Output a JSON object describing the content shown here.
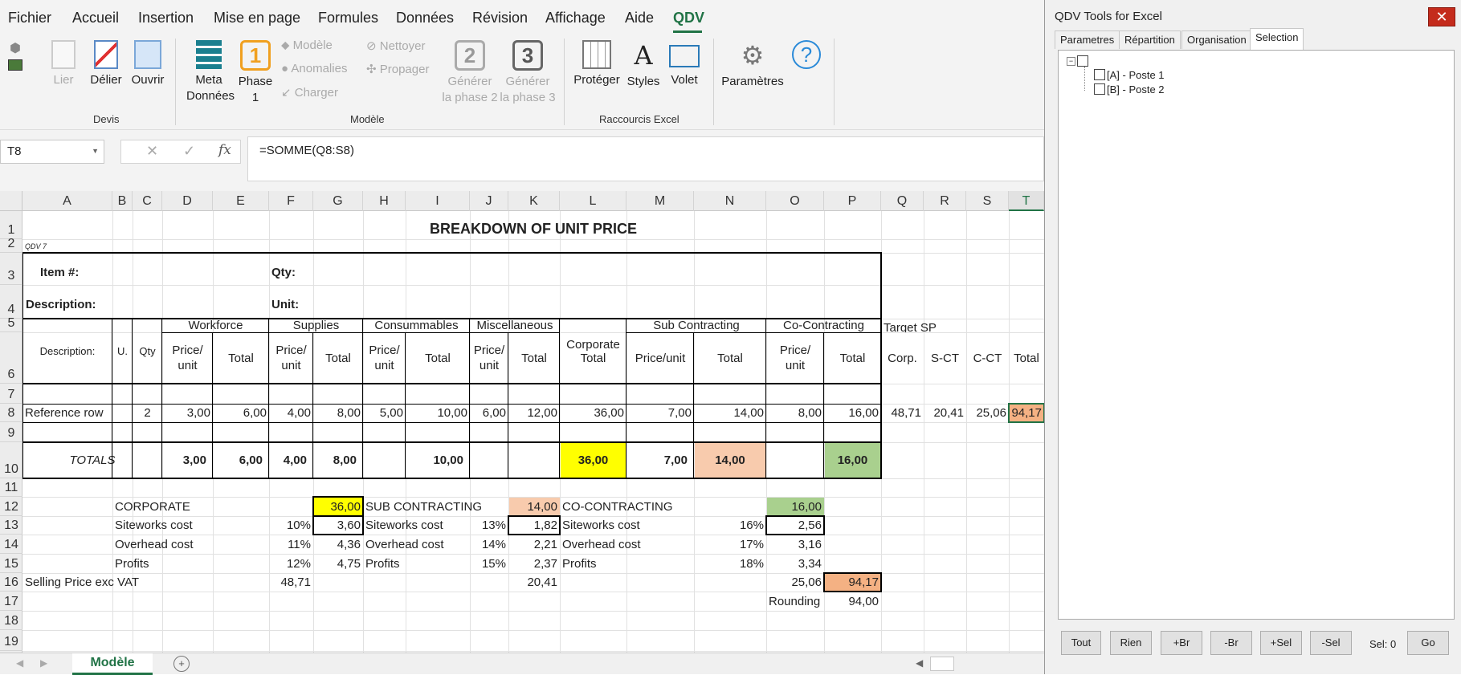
{
  "menu": [
    "Fichier",
    "Accueil",
    "Insertion",
    "Mise en page",
    "Formules",
    "Données",
    "Révision",
    "Affichage",
    "Aide",
    "QDV"
  ],
  "ribbon": {
    "lier": "Lier",
    "delier": "Délier",
    "ouvrir": "Ouvrir",
    "devis_group": "Devis",
    "meta": "Meta",
    "meta2": "Données",
    "phase": "Phase",
    "phase_num": "1",
    "phase_icon_num": "1",
    "modele": "Modèle",
    "anomalies": "Anomalies",
    "charger": "Charger",
    "nettoyer": "Nettoyer",
    "propager": "Propager",
    "gen2_num": "2",
    "gen3_num": "3",
    "gen_label": "Générer",
    "gen2_sub": "la phase 2",
    "gen3_sub": "la phase 3",
    "modele_group": "Modèle",
    "proteger": "Protéger",
    "styles": "Styles",
    "volet": "Volet",
    "raccourcis_group": "Raccourcis Excel",
    "parametres": "Paramètres"
  },
  "formula": {
    "namebox": "T8",
    "content": "=SOMME(Q8:S8)",
    "fx": "fx"
  },
  "columns": [
    "A",
    "B",
    "C",
    "D",
    "E",
    "F",
    "G",
    "H",
    "I",
    "J",
    "K",
    "L",
    "M",
    "N",
    "O",
    "P",
    "Q",
    "R",
    "S",
    "T"
  ],
  "rows": [
    "1",
    "2",
    "3",
    "4",
    "5",
    "6",
    "7",
    "8",
    "9",
    "10",
    "11",
    "12",
    "13",
    "14",
    "15",
    "16",
    "17",
    "18",
    "19"
  ],
  "sheet": {
    "title": "BREAKDOWN OF UNIT PRICE",
    "qdv": "QDV 7",
    "item": "Item #:",
    "qty": "Qty:",
    "description": "Description:",
    "unit": "Unit:",
    "h_desc": "Description:",
    "h_u": "U.",
    "h_qty": "Qty",
    "workforce": "Workforce",
    "supplies": "Supplies",
    "consummables": "Consummables",
    "misc": "Miscellaneous",
    "corporate": "Corporate",
    "corporate2": "Total",
    "sub": "Sub Contracting",
    "co": "Co-Contracting",
    "target": "Target SP",
    "price": "Price/",
    "unit_l": "unit",
    "total": "Total",
    "price_unit": "Price/unit",
    "corp": "Corp.",
    "sct": "S-CT",
    "cct": "C-CT",
    "r8": {
      "a": "Reference row",
      "c": "2",
      "d": "3,00",
      "e": "6,00",
      "f": "4,00",
      "g": "8,00",
      "h": "5,00",
      "i": "10,00",
      "j": "6,00",
      "k": "12,00",
      "l": "36,00",
      "m": "7,00",
      "n": "14,00",
      "o": "8,00",
      "p": "16,00",
      "q": "48,71",
      "r": "20,41",
      "s": "25,06",
      "t": "94,17"
    },
    "totals": "TOTALS",
    "r10": {
      "d": "3,00",
      "e": "6,00",
      "f": "4,00",
      "g": "8,00",
      "i": "10,00",
      "l": "36,00",
      "m": "7,00",
      "n": "14,00",
      "p": "16,00"
    },
    "corp_lbl": "CORPORATE",
    "corp_val": "36,00",
    "site": "Siteworks cost",
    "over": "Overhead cost",
    "profits": "Profits",
    "c13p": "10%",
    "c13v": "3,60",
    "c14p": "11%",
    "c14v": "4,36",
    "c15p": "12%",
    "c15v": "4,75",
    "sub_lbl": "SUB CONTRACTING",
    "sub_val": "14,00",
    "s13p": "13%",
    "s13v": "1,82",
    "s14p": "14%",
    "s14v": "2,21",
    "s15p": "15%",
    "s15v": "2,37",
    "co_lbl": "CO-CONTRACTING",
    "co_val": "16,00",
    "o13p": "16%",
    "o13v": "2,56",
    "o14p": "17%",
    "o14v": "3,16",
    "o15p": "18%",
    "o15v": "3,34",
    "selling": "Selling Price  exc VAT",
    "sp_corp": "48,71",
    "sp_sub": "20,41",
    "sp_co": "25,06",
    "sp_total": "94,17",
    "rounding": "Rounding",
    "rounding_val": "94,00"
  },
  "tab": "Modèle",
  "panel": {
    "title": "QDV Tools for Excel",
    "close": "✕",
    "tabs": [
      "Parametres",
      "Répartition",
      "Organisation",
      "Selection"
    ],
    "tree": [
      "[A] - Poste 1",
      "[B] - Poste 2"
    ],
    "buttons": [
      "Tout",
      "Rien",
      "+Br",
      "-Br",
      "+Sel",
      "-Sel"
    ],
    "sel": "Sel: 0",
    "go": "Go"
  },
  "colors": {
    "yellow": "#ffff00",
    "salmon": "#f8cbad",
    "green": "#a9d08e",
    "orange": "#f4b183",
    "accent": "#217346"
  }
}
